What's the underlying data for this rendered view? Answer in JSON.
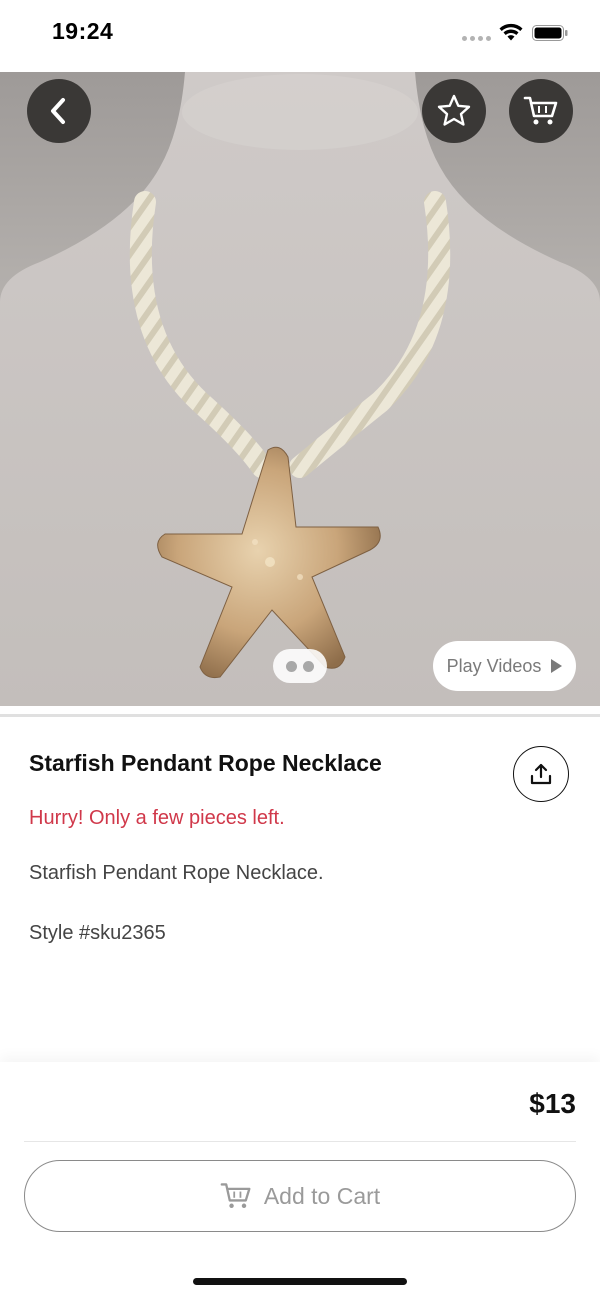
{
  "status_bar": {
    "time": "19:24"
  },
  "product": {
    "image_alt": "Starfish pendant on rope necklace",
    "image_pages": 2,
    "active_page": 0,
    "play_videos_label": "Play Videos",
    "title": "Starfish Pendant Rope Necklace",
    "stock_warning": "Hurry! Only a few pieces left.",
    "description": "Starfish Pendant Rope Necklace.",
    "style": "Style #sku2365",
    "price": "$13"
  },
  "actions": {
    "add_to_cart_label": "Add to Cart"
  },
  "icons": {
    "back": "chevron-left-icon",
    "favorite": "star-outline-icon",
    "cart": "cart-icon",
    "share": "share-icon",
    "play": "play-icon"
  },
  "colors": {
    "accent_warning": "#d0384a",
    "dark_button": "#3a3836",
    "text": "#111111"
  }
}
